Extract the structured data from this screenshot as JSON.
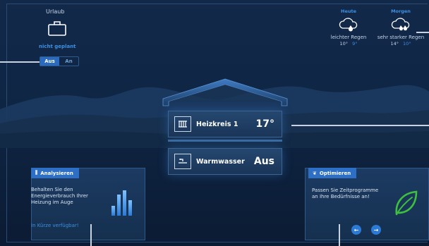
{
  "vacation": {
    "label": "Urlaub",
    "status": "nicht geplant",
    "toggle": {
      "off_label": "Aus",
      "on_label": "An",
      "selected": "Aus"
    }
  },
  "weather": {
    "today": {
      "day": "Heute",
      "description": "leichter Regen",
      "high": "10°",
      "low": "9°",
      "icon": "cloud-rain-icon"
    },
    "tomorrow": {
      "day": "Morgen",
      "description": "sehr starker Regen",
      "high": "14°",
      "low": "10°",
      "icon": "cloud-heavy-rain-icon"
    }
  },
  "house": {
    "heating": {
      "label": "Heizkreis 1",
      "value": "17°",
      "icon": "radiator-icon"
    },
    "water": {
      "label": "Warmwasser",
      "value": "Aus",
      "icon": "faucet-icon"
    }
  },
  "analyze_card": {
    "tab_label": "Analysieren",
    "text_lines": [
      "Behalten Sie den",
      "Energieverbrauch Ihrer",
      "Heizung im Auge"
    ],
    "coming_soon": "In Kürze verfügbar!",
    "icon": "bar-chart-icon"
  },
  "optimize_card": {
    "tab_label": "Optimieren",
    "text_lines": [
      "Passen Sie Zeitprogramme",
      "an Ihre Bedürfnisse an!"
    ],
    "icon": "leaf-icon",
    "prev_label": "←",
    "next_label": "→"
  },
  "colors": {
    "background": "#12294a",
    "accent": "#2c6fc4",
    "accent_text": "#3f8fe0",
    "tile": "#1f3f66",
    "leaf": "#3fbf3f"
  }
}
